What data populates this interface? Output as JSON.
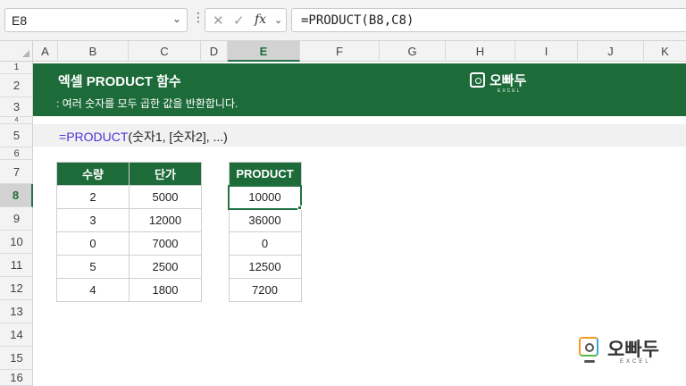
{
  "namebox": {
    "value": "E8",
    "dropdown_glyph": "⌄"
  },
  "formula_bar": {
    "dots": "⋮",
    "cancel_glyph": "✕",
    "enter_glyph": "✓",
    "fx_label": "fx",
    "fx_chevron": "⌄",
    "formula": "=PRODUCT(B8,C8)"
  },
  "columns": [
    "A",
    "B",
    "C",
    "D",
    "E",
    "F",
    "G",
    "H",
    "I",
    "J",
    "K"
  ],
  "selected_column": "E",
  "rows": [
    "1",
    "2",
    "3",
    "4",
    "5",
    "6",
    "7",
    "8",
    "9",
    "10",
    "11",
    "12",
    "13",
    "14",
    "15",
    "16"
  ],
  "selected_row": "8",
  "banner": {
    "title": "엑셀 PRODUCT 함수",
    "subtitle": ": 여러 숫자를 모두 곱한 값을 반환합니다.",
    "logo_text": "오빠두",
    "logo_sub": "EXCEL"
  },
  "syntax": {
    "prefix": "=",
    "function_name": "PRODUCT",
    "args": "(숫자1, [숫자2], ...)"
  },
  "table1": {
    "headers": [
      "수량",
      "단가"
    ],
    "rows": [
      [
        "2",
        "5000"
      ],
      [
        "3",
        "12000"
      ],
      [
        "0",
        "7000"
      ],
      [
        "5",
        "2500"
      ],
      [
        "4",
        "1800"
      ]
    ]
  },
  "table2": {
    "header": "PRODUCT",
    "values": [
      "10000",
      "36000",
      "0",
      "12500",
      "7200"
    ]
  },
  "footer_logo": {
    "text": "오빠두",
    "sub": "EXCEL"
  },
  "colors": {
    "excel_green": "#1e6b3a",
    "function_blue": "#4a36d6"
  }
}
